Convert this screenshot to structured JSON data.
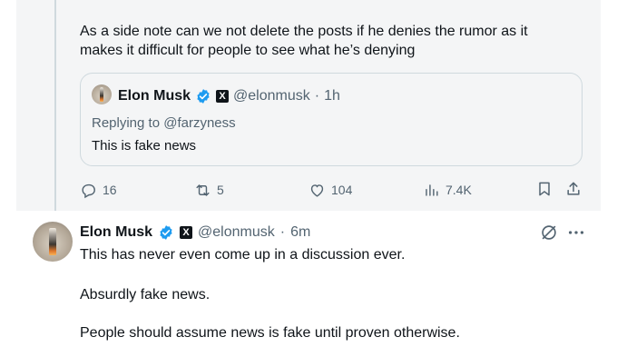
{
  "parent_tweet": {
    "text_line1": "As a side note can we not delete the posts if he denies the rumor as it",
    "text_line2": "makes it difficult for people to see what he’s denying",
    "quote": {
      "name": "Elon Musk",
      "handle": "@elonmusk",
      "separator": "·",
      "time": "1h",
      "replying_to": "Replying to @farzyness",
      "text": "This is fake news"
    },
    "actions": {
      "replies": "16",
      "reposts": "5",
      "likes": "104",
      "views": "7.4K"
    },
    "icons": [
      "reply-icon",
      "repost-icon",
      "like-icon",
      "views-icon",
      "bookmark-icon",
      "share-icon"
    ]
  },
  "reply_tweet": {
    "name": "Elon Musk",
    "handle": "@elonmusk",
    "separator": "·",
    "time": "6m",
    "lines": [
      "This has never even come up in a discussion ever.",
      "Absurdly fake news.",
      "People should assume news is fake until proven otherwise."
    ],
    "icons": [
      "grok-icon",
      "more-icon"
    ]
  },
  "colors": {
    "background_highlight": "#f4f5f6",
    "verified_blue": "#1d9bf0",
    "muted_text": "#536471",
    "border": "#cfd9de"
  }
}
